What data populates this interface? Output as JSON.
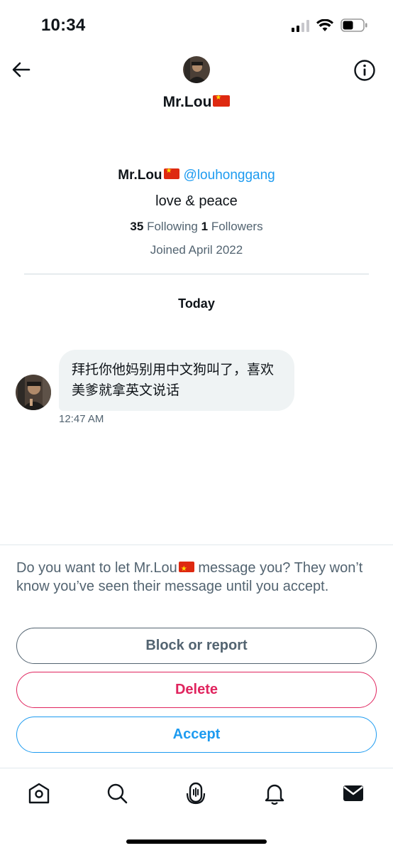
{
  "status_bar": {
    "time": "10:34",
    "icons": [
      "cellular-signal-icon",
      "wifi-icon",
      "battery-icon"
    ]
  },
  "header": {
    "title": "Mr.Lou",
    "title_flag": "china-flag-emoji",
    "icons": [
      "back-arrow-icon",
      "info-icon"
    ]
  },
  "profile": {
    "name": "Mr.Lou",
    "handle": "@louhonggang",
    "bio": "love & peace",
    "following_count": "35",
    "following_label": "Following",
    "followers_count": "1",
    "followers_label": "Followers",
    "joined": "Joined April 2022"
  },
  "conversation": {
    "day_label": "Today",
    "messages": [
      {
        "text": "拜托你他妈别用中文狗叫了，喜欢美爹就拿英文说话",
        "time": "12:47 AM"
      }
    ]
  },
  "request": {
    "prompt_before": "Do you want to let Mr.Lou",
    "prompt_after": " message you? They won’t know you’ve seen their message until you accept.",
    "block_label": "Block or report",
    "delete_label": "Delete",
    "accept_label": "Accept"
  },
  "tab_bar": {
    "items": [
      "home-icon",
      "search-icon",
      "spaces-icon",
      "notifications-icon",
      "messages-icon"
    ],
    "active": "messages-icon"
  },
  "colors": {
    "accent": "#1d9bf0",
    "danger": "#e0245e",
    "secondary_text": "#536471",
    "bubble": "#eff3f4"
  }
}
